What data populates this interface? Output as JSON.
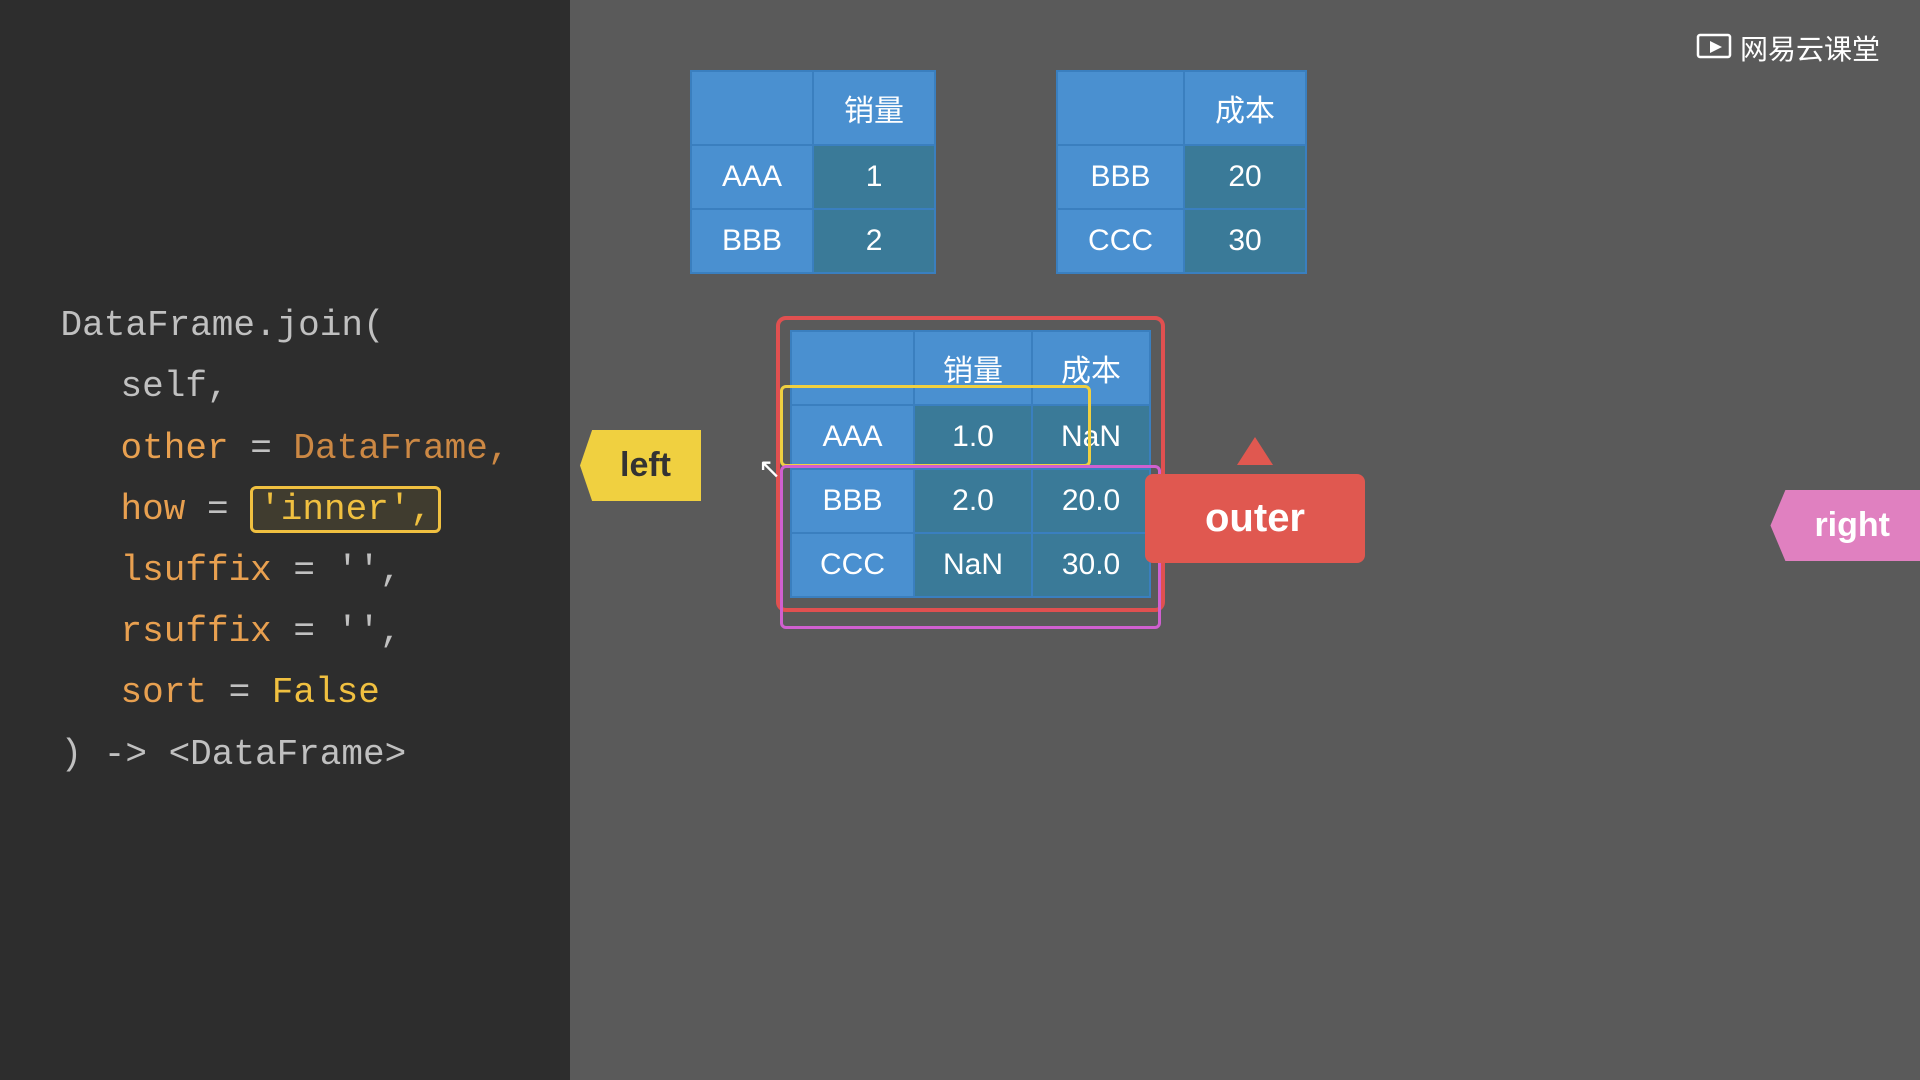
{
  "left_panel": {
    "code": {
      "line1": "DataFrame.join(",
      "line2": "self,",
      "line3_prefix": "other = ",
      "line3_value": "DataFrame,",
      "line4_prefix": "how = ",
      "line4_value": "'inner',",
      "line5_prefix": "lsuffix = ",
      "line5_value": "'',",
      "line6_prefix": "rsuffix = ",
      "line6_value": "'',",
      "line7_prefix": "sort = ",
      "line7_value": "False",
      "line8": ") -> <DataFrame>"
    }
  },
  "watermark": {
    "text": "网易云课堂"
  },
  "left_table": {
    "header": [
      "",
      "销量"
    ],
    "rows": [
      [
        "AAA",
        "1"
      ],
      [
        "BBB",
        "2"
      ]
    ]
  },
  "right_table": {
    "header": [
      "",
      "成本"
    ],
    "rows": [
      [
        "BBB",
        "20"
      ],
      [
        "CCC",
        "30"
      ]
    ]
  },
  "result_table": {
    "header": [
      "",
      "销量",
      "成本"
    ],
    "rows": [
      [
        "AAA",
        "1.0",
        "NaN"
      ],
      [
        "BBB",
        "2.0",
        "20.0"
      ],
      [
        "CCC",
        "NaN",
        "30.0"
      ]
    ]
  },
  "labels": {
    "left": "left",
    "right": "right",
    "outer": "outer"
  }
}
